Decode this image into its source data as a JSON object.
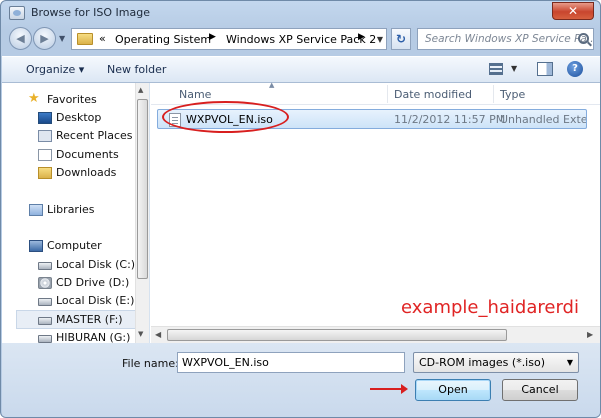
{
  "window": {
    "title": "Browse for ISO Image",
    "close_glyph": "✕"
  },
  "navbar": {
    "back_glyph": "◀",
    "forward_glyph": "▶",
    "breadcrumb_sep": "«",
    "crumbs": [
      "Operating Sistem",
      "Windows XP Service Pack 2"
    ],
    "crumb_arrow": "▶",
    "refresh_glyph": "↻",
    "search_placeholder": "Search Windows XP Service Pa..."
  },
  "toolbar": {
    "organize_label": "Organize ▾",
    "new_folder_label": "New folder",
    "views_drop": "▼",
    "help_glyph": "?"
  },
  "sidebar": {
    "items": [
      {
        "label": "Favorites",
        "icon": "star-icon"
      },
      {
        "label": "Desktop",
        "icon": "desktop-icon"
      },
      {
        "label": "Recent Places",
        "icon": "recent-places-icon"
      },
      {
        "label": "Documents",
        "icon": "documents-icon"
      },
      {
        "label": "Downloads",
        "icon": "downloads-icon"
      },
      {
        "label": "Libraries",
        "icon": "libraries-icon"
      },
      {
        "label": "Computer",
        "icon": "computer-icon"
      },
      {
        "label": "Local Disk (C:)",
        "icon": "disk-icon"
      },
      {
        "label": "CD Drive (D:)",
        "icon": "cd-drive-icon"
      },
      {
        "label": "Local Disk (E:)",
        "icon": "disk-icon"
      },
      {
        "label": "MASTER (F:)",
        "icon": "disk-icon"
      },
      {
        "label": "HIBURAN (G:)",
        "icon": "disk-icon"
      }
    ]
  },
  "columns": {
    "name": "Name",
    "date_modified": "Date modified",
    "type": "Type"
  },
  "files": [
    {
      "name": "WXPVOL_EN.iso",
      "date": "11/2/2012 11:57 PM",
      "type": "Unhandled Extensi..."
    }
  ],
  "watermark": "example_haidarerdi",
  "footer": {
    "file_name_label": "File name:",
    "file_name_value": "WXPVOL_EN.iso",
    "file_type_value": "CD-ROM images (*.iso)",
    "open_label": "Open",
    "cancel_label": "Cancel"
  },
  "colors": {
    "annotation_red": "#d81f1f",
    "selection_blue": "#cde3f8"
  }
}
